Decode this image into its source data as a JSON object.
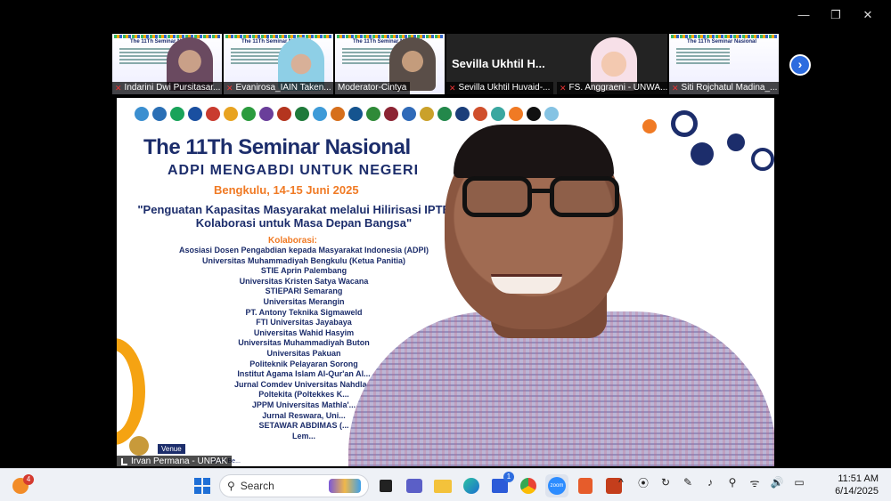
{
  "window": {
    "controls": [
      "—",
      "❐",
      "✕"
    ]
  },
  "gallery": [
    {
      "name": "Indarini Dwi Pursitasar...",
      "muted": true,
      "type": "slide",
      "avatar": "hijab1"
    },
    {
      "name": "Evanirosa_IAIN Taken...",
      "muted": true,
      "type": "slide",
      "avatar": "hijab2"
    },
    {
      "name": "Moderator-Cintya",
      "muted": false,
      "type": "slide",
      "avatar": "hijab3"
    },
    {
      "name": "Sevilla Ukhtil Huvaid-...",
      "muted": true,
      "type": "text",
      "bigname": "Sevilla Ukhtil H..."
    },
    {
      "name": "FS. Anggraeni - UNWA...",
      "muted": true,
      "type": "photo",
      "avatar": "baby"
    },
    {
      "name": "Siti Rojchatul Madina_...",
      "muted": true,
      "type": "slide"
    }
  ],
  "gallery_next": "›",
  "slide": {
    "title": "The 11Th Seminar Nasional",
    "subtitle": "ADPI MENGABDI UNTUK NEGERI",
    "date": "Bengkulu, 14-15 Juni 2025",
    "theme": "\"Penguatan Kapasitas Masyarakat melalui Hilirisasi IPTEKS: Kolaborasi untuk Masa Depan Bangsa\"",
    "kolaborasi_heading": "Kolaborasi:",
    "kolaborasi": [
      "Asosiasi Dosen Pengabdian kepada Masyarakat Indonesia (ADPI)",
      "Universitas Muhammadiyah Bengkulu (Ketua Panitia)",
      "STIE Aprin Palembang",
      "Universitas Kristen Satya Wacana",
      "STIEPARI Semarang",
      "Universitas Merangin",
      "PT. Antony Teknika Sigmaweld",
      "FTI Universitas Jayabaya",
      "Universitas Wahid Hasyim",
      "Universitas Muhammadiyah Buton",
      "Universitas Pakuan",
      "Politeknik Pelayaran Sorong",
      "Institut Agama Islam Al-Qur'an Al...",
      "Jurnal Comdev Universitas Nahdla...",
      "Poltekita (Poltekkes K...",
      "JPPM Universitas Mathla'...",
      "Jurnal Reswara, Uni...",
      "SETAWAR ABDIMAS (...",
      "Lem..."
    ],
    "venue": "Venue",
    "venue_detail": "...diyah Be..."
  },
  "main_speaker": {
    "name": "Irvan Permana - UNPAK"
  },
  "taskbar": {
    "weather_badge": "4",
    "search_placeholder": "Search",
    "apps": [
      "start-icon",
      "task-view-icon",
      "teams-icon",
      "file-explorer-icon",
      "edge-icon",
      "store-icon",
      "chrome-icon",
      "zoom-icon",
      "office-icon",
      "powerpoint-icon"
    ],
    "store_badge": "1",
    "tray": [
      "^",
      "⦿",
      "↻",
      "✎",
      "♪",
      "⚲",
      "ᯤ",
      "🔊",
      "▭"
    ],
    "time": "11:51 AM",
    "date": "6/14/2025"
  },
  "colors": {
    "navy": "#1c2d6b",
    "orange": "#f07a24",
    "zoom_blue": "#2d6cdf",
    "mute_red": "#e33333"
  }
}
